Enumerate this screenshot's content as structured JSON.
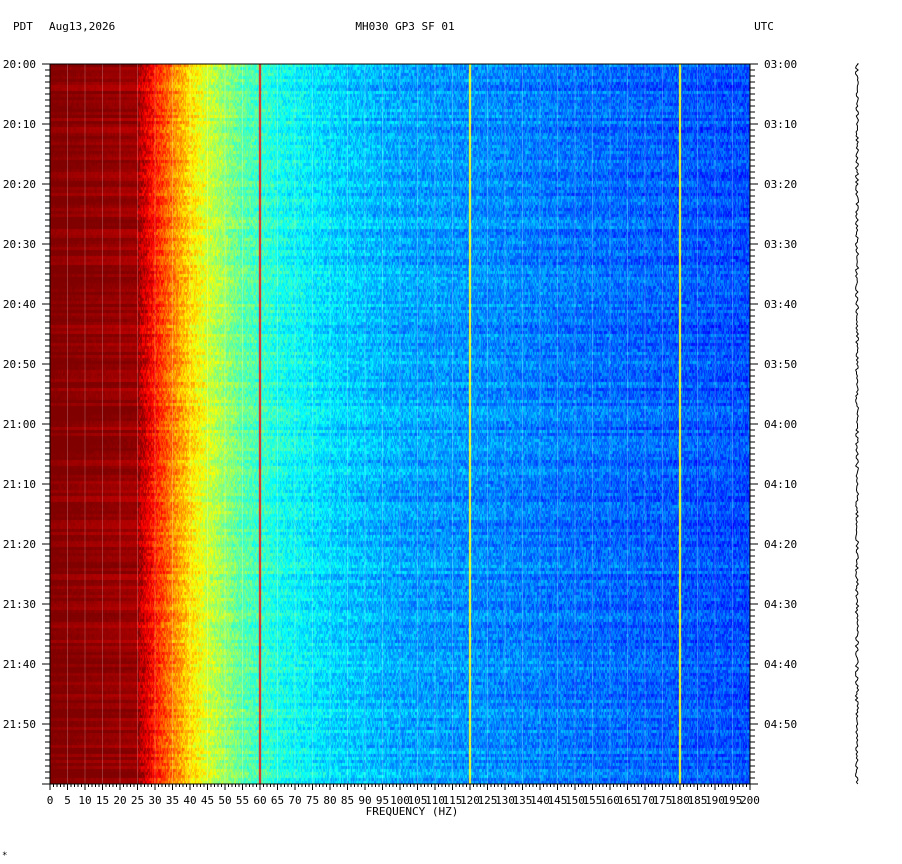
{
  "chart_data": {
    "type": "heatmap",
    "title": "MH030 GP3 SF 01",
    "date": "Aug13,2026",
    "left_timezone": "PDT",
    "right_timezone": "UTC",
    "xlabel": "FREQUENCY (HZ)",
    "xlim": [
      0,
      200
    ],
    "x_ticks": [
      "0",
      "5",
      "10",
      "15",
      "20",
      "25",
      "30",
      "35",
      "40",
      "45",
      "50",
      "55",
      "60",
      "65",
      "70",
      "75",
      "80",
      "85",
      "90",
      "95",
      "100",
      "105",
      "110",
      "115",
      "120",
      "125",
      "130",
      "135",
      "140",
      "145",
      "150",
      "155",
      "160",
      "165",
      "170",
      "175",
      "180",
      "185",
      "190",
      "195",
      "200"
    ],
    "time_range_minutes": 120,
    "left_time_labels": [
      "20:00",
      "20:10",
      "20:20",
      "20:30",
      "20:40",
      "20:50",
      "21:00",
      "21:10",
      "21:20",
      "21:30",
      "21:40",
      "21:50"
    ],
    "right_time_labels": [
      "03:00",
      "03:10",
      "03:20",
      "03:30",
      "03:40",
      "03:50",
      "04:00",
      "04:10",
      "04:20",
      "04:30",
      "04:40",
      "04:50"
    ],
    "colormap": [
      "#00007f",
      "#0000ff",
      "#0080ff",
      "#00ffff",
      "#80ff80",
      "#ffff00",
      "#ff8000",
      "#ff0000",
      "#800000"
    ],
    "spectral_profile": {
      "description_freq_hz": [
        0,
        25,
        30,
        35,
        40,
        45,
        55,
        65,
        80,
        100,
        150,
        200
      ],
      "relative_power": [
        1.0,
        0.97,
        0.85,
        0.75,
        0.66,
        0.58,
        0.47,
        0.4,
        0.34,
        0.29,
        0.24,
        0.2
      ]
    },
    "strong_lines_hz": [
      60,
      120,
      180
    ],
    "footnote_mark": "*"
  }
}
